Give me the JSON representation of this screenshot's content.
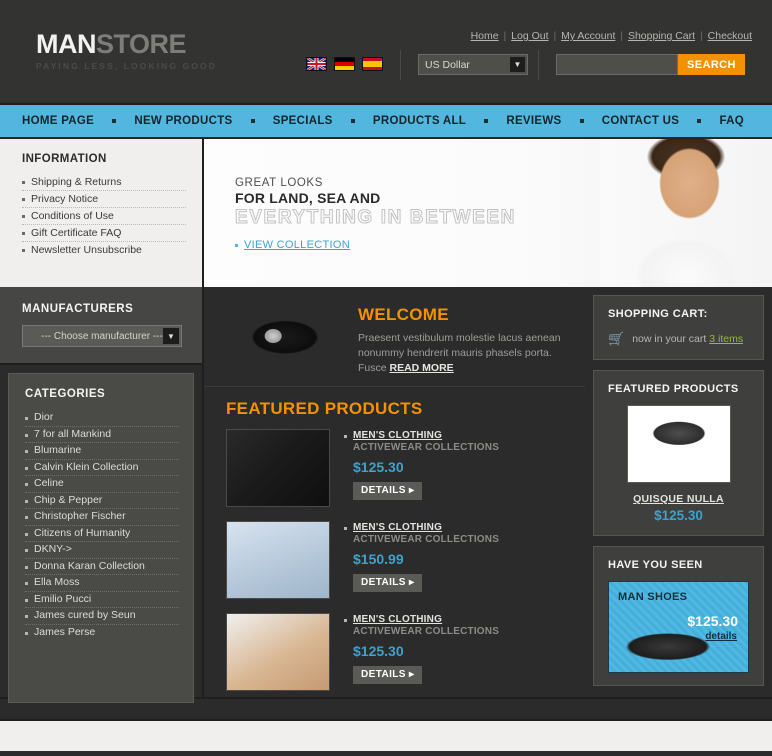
{
  "header": {
    "logo_main": "MAN",
    "logo_accent": "STORE",
    "tagline": "PAYING LESS, LOOKING GOOD",
    "top_links": [
      "Home",
      "Log Out",
      "My Account",
      "Shopping Cart",
      "Checkout"
    ],
    "flags": [
      "uk-flag-icon",
      "germany-flag-icon",
      "spain-flag-icon"
    ],
    "currency": {
      "value": "US Dollar",
      "arrow": "chevron-down-icon"
    },
    "search": {
      "value": "",
      "placeholder": "",
      "button_label": "SEARCH"
    }
  },
  "nav": {
    "items": [
      "HOME PAGE",
      "NEW PRODUCTS",
      "SPECIALS",
      "PRODUCTS ALL",
      "REVIEWS",
      "CONTACT US",
      "FAQ"
    ]
  },
  "information": {
    "title": "INFORMATION",
    "items": [
      "Shipping & Returns",
      "Privacy Notice",
      "Conditions of Use",
      "Gift Certificate FAQ",
      "Newsletter Unsubscribe"
    ]
  },
  "banner": {
    "line1": "GREAT LOOKS",
    "line2": "FOR LAND, SEA AND",
    "line3": "EVERYTHING IN BETWEEN",
    "cta": "VIEW COLLECTION"
  },
  "manufacturers": {
    "title": "MANUFACTURERS",
    "select_value": "--- Choose manufacturer ---",
    "arrow": "chevron-down-icon"
  },
  "categories": {
    "title": "CATEGORIES",
    "items": [
      "Dior",
      "7 for all Mankind",
      "Blumarine",
      "Calvin Klein Collection",
      "Celine",
      "Chip & Pepper",
      "Christopher Fischer",
      "Citizens of Humanity",
      "DKNY->",
      "Donna Karan Collection",
      "Ella Moss",
      "Emilio Pucci",
      "James cured by Seun",
      "James Perse"
    ]
  },
  "welcome": {
    "title": "WELCOME",
    "body": "Praesent vestibulum molestie lacus aenean nonummy hendrerit mauris phasels porta. Fusce ",
    "read_more": "READ MORE"
  },
  "featured": {
    "title": "FEATURED PRODUCTS",
    "details_label": "DETAILS",
    "details_arrow": "chevron-right-icon",
    "products": [
      {
        "name": "MEN'S CLOTHING",
        "sub": "ACTIVEWEAR COLLECTIONS",
        "price": "$125.30"
      },
      {
        "name": "MEN'S CLOTHING",
        "sub": "ACTIVEWEAR COLLECTIONS",
        "price": "$150.99"
      },
      {
        "name": "MEN'S CLOTHING",
        "sub": "ACTIVEWEAR COLLECTIONS",
        "price": "$125.30"
      }
    ]
  },
  "cart": {
    "title": "SHOPPING CART:",
    "icon": "shopping-cart-icon",
    "text": "now in your cart ",
    "items_link": "3 items"
  },
  "sidebar_featured": {
    "title": "FEATURED PRODUCTS",
    "product_name": "QUISQUE NULLA",
    "product_price": "$125.30"
  },
  "have_you_seen": {
    "title": "HAVE YOU SEEN",
    "product_name": "MAN SHOES",
    "price": "$125.30",
    "details": "details"
  },
  "colors": {
    "nav_blue": "#52b6de",
    "accent_orange": "#f39200",
    "price_blue": "#3ba3ce",
    "cart_green": "#9bbb2e",
    "dark_bg": "#2b2b2b",
    "panel_light": "#f0efed"
  }
}
